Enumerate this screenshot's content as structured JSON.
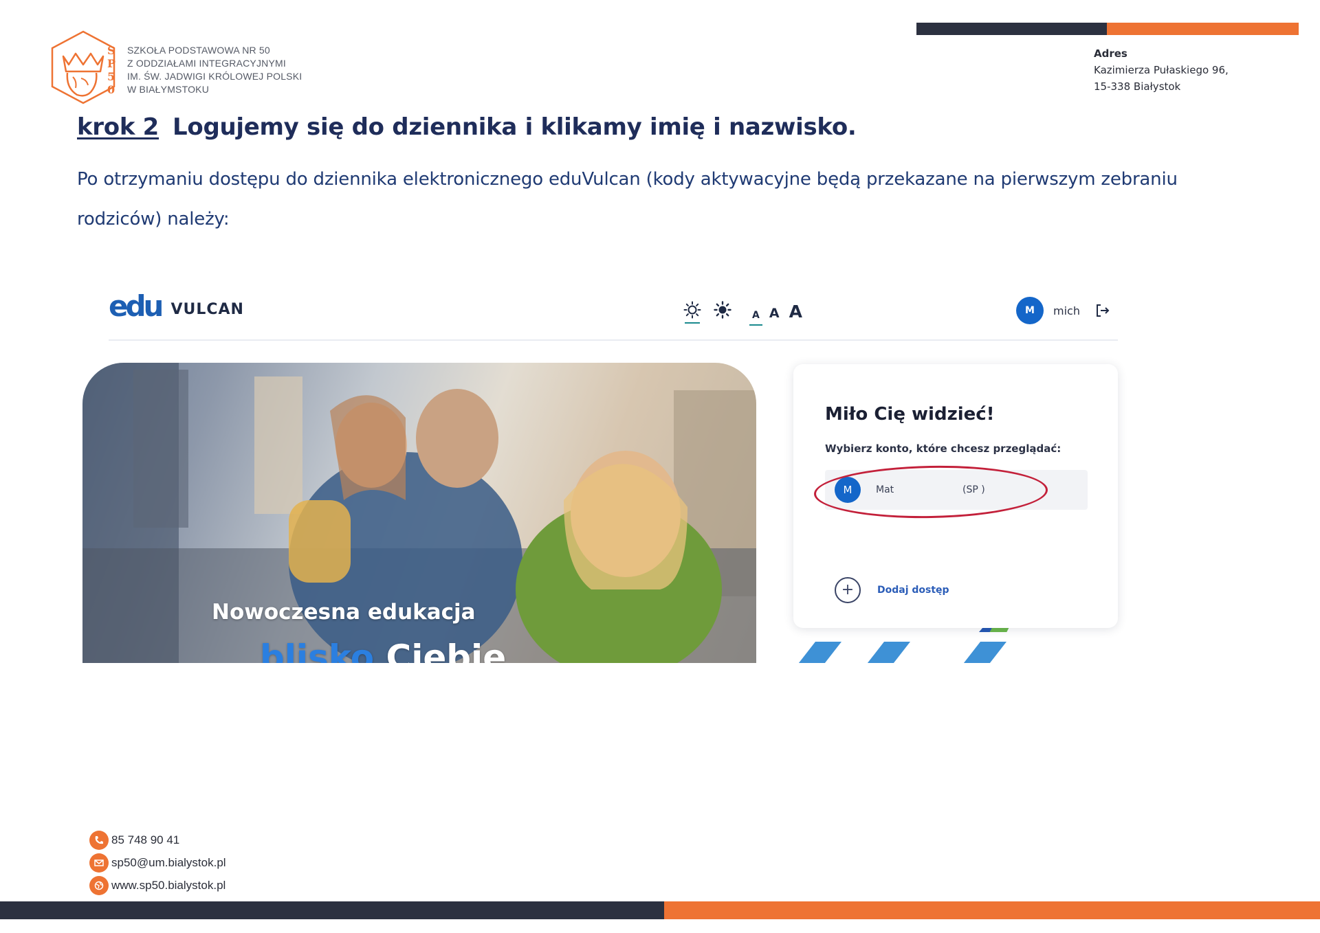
{
  "letterhead": {
    "logo_letters": [
      "S",
      "P",
      "5",
      "0"
    ],
    "school_lines": [
      "SZKOŁA PODSTAWOWA NR 50",
      "Z ODDZIAŁAMI INTEGRACYJNYMI",
      "IM. ŚW. JADWIGI KRÓLOWEJ POLSKI",
      "W BIAŁYMSTOKU"
    ],
    "address_title": "Adres",
    "address_line1": "Kazimierza Pułaskiego 96,",
    "address_line2": "15-338 Białystok",
    "colors": {
      "dark": "#2c3140",
      "orange": "#ee7333"
    }
  },
  "content": {
    "step_label": "krok 2",
    "step_title": "Logujemy się do dziennika i klikamy imię i nazwisko.",
    "intro_text": "Po otrzymaniu dostępu do dziennika elektronicznego eduVulcan (kody aktywacyjne będą przekazane na pierwszym zebraniu rodziców) należy:"
  },
  "screenshot": {
    "logo_mark": "edu",
    "logo_brand": "VULCAN",
    "font_sizes": [
      "A",
      "A",
      "A"
    ],
    "user_initial": "M",
    "user_name": "mich",
    "hero_line1": "Nowoczesna edukacja",
    "hero_line2_blue": "blisko",
    "hero_line2_white": "Ciebie",
    "card_title": "Miło Cię widzieć!",
    "card_subtitle": "Wybierz konto, które chcesz przeglądać:",
    "account_initial": "M",
    "account_name": "Mat",
    "account_school": "(SP  )",
    "add_access_label": "Dodaj dostęp",
    "highlight_color": "#c3203a",
    "accent_color": "#1466c9"
  },
  "footer": {
    "phone": "85 748 90 41",
    "email": "sp50@um.bialystok.pl",
    "website": "www.sp50.bialystok.pl"
  }
}
